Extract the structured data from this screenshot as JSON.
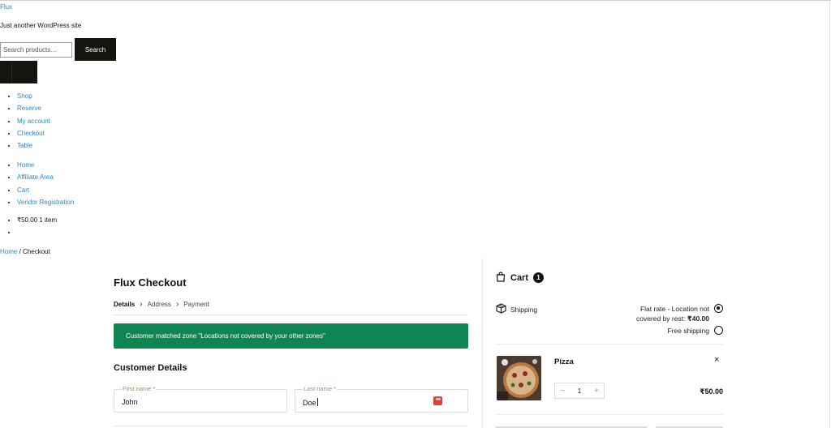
{
  "site": {
    "title": "Flux",
    "tagline": "Just another WordPress site"
  },
  "search": {
    "placeholder": "Search products…",
    "button_label": "Search"
  },
  "menu_primary": [
    "Shop",
    "Reserve",
    "My account",
    "Checkout",
    "Table"
  ],
  "menu_secondary": [
    "Home",
    "Affiliate Area",
    "Cart",
    "Vendor Registration"
  ],
  "mini_cart": {
    "summary": "₹50.00 1 item"
  },
  "breadcrumb": {
    "home": "Home",
    "separator": " / ",
    "current": "Checkout"
  },
  "checkout": {
    "title": "Flux Checkout",
    "steps": [
      "Details",
      "Address",
      "Payment"
    ],
    "notice": "Customer matched zone \"Locations not covered by your other zones\"",
    "section_title": "Customer Details",
    "first_name": {
      "label": "First name *",
      "value": "John"
    },
    "last_name": {
      "label": "Last name *",
      "value": "Doe"
    }
  },
  "cart": {
    "title": "Cart",
    "count": "1",
    "shipping_label": "Shipping",
    "shipping_options": [
      {
        "line1": "Flat rate - Location not",
        "line2_prefix": "covered by rest: ",
        "line2_price": "₹40.00",
        "selected": true
      },
      {
        "line1": "Free shipping",
        "selected": false
      }
    ],
    "item": {
      "name": "Pizza",
      "quantity": "1",
      "price": "₹50.00",
      "minus": "−",
      "plus": "+",
      "remove": "×"
    }
  },
  "colors": {
    "notice_bg": "#0f8551",
    "link": "#2e86c9",
    "dark_button": "#16140f",
    "label_green": "#7aa468"
  }
}
